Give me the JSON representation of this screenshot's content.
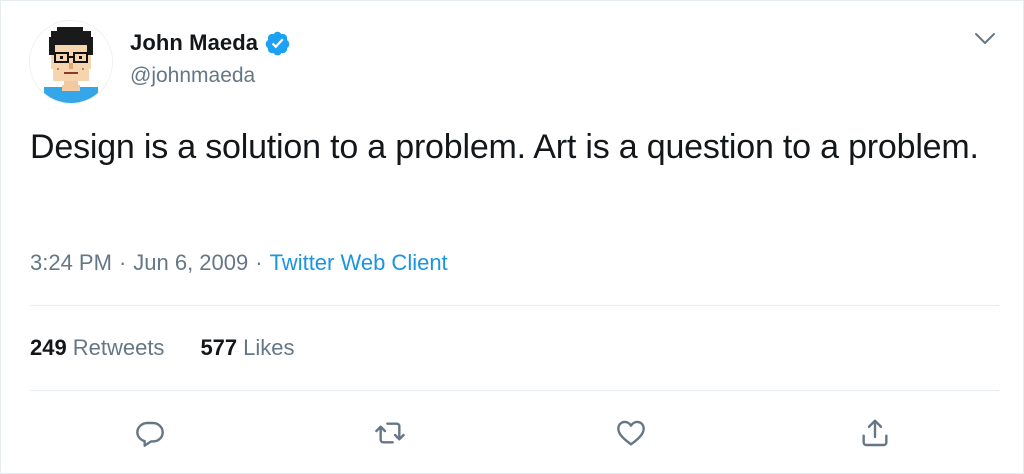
{
  "tweet": {
    "author": {
      "name": "John Maeda",
      "handle": "@johnmaeda",
      "verified": true
    },
    "text": "Design is a solution to a problem. Art is a question to a problem.",
    "meta": {
      "time": "3:24 PM",
      "separator": "·",
      "date": "Jun 6, 2009",
      "source": "Twitter Web Client"
    },
    "stats": {
      "retweets_count": "249",
      "retweets_label": "Retweets",
      "likes_count": "577",
      "likes_label": "Likes"
    },
    "actions": [
      {
        "name": "reply",
        "icon": "reply-icon"
      },
      {
        "name": "retweet",
        "icon": "retweet-icon"
      },
      {
        "name": "like",
        "icon": "heart-icon"
      },
      {
        "name": "share",
        "icon": "share-icon"
      }
    ],
    "colors": {
      "text": "#14171a",
      "secondary": "#657786",
      "link": "#1b95e0",
      "verified": "#1da1f2",
      "divider": "#e6ecf0"
    }
  }
}
